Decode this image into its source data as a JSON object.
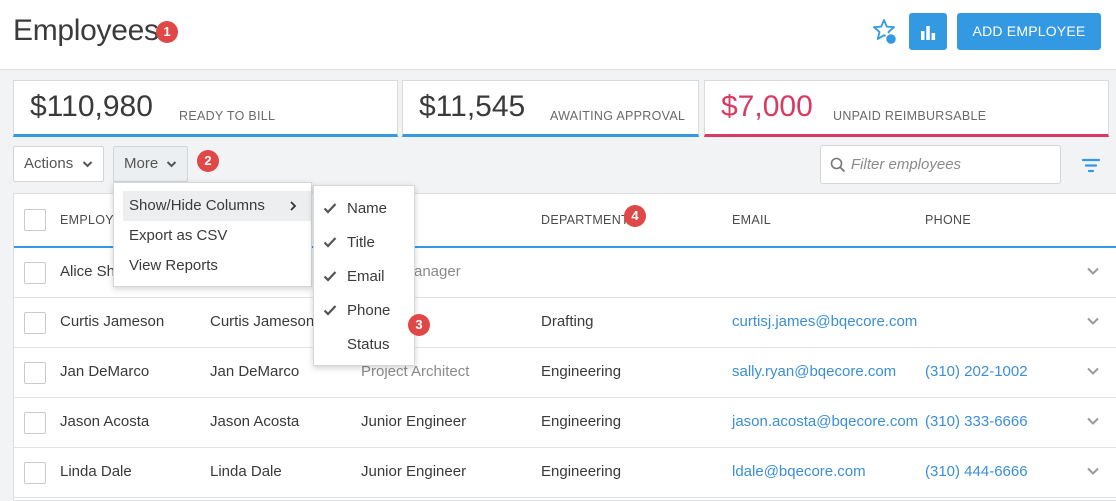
{
  "header": {
    "title": "Employees",
    "badge": "1",
    "add_button": "ADD EMPLOYEE",
    "icons": [
      "star-notification-icon",
      "bar-chart-icon"
    ]
  },
  "kpis": [
    {
      "value": "$110,980",
      "label": "READY TO BILL",
      "color": "#3499e3"
    },
    {
      "value": "$11,545",
      "label": "AWAITING APPROVAL",
      "color": "#3499e3"
    },
    {
      "value": "$7,000",
      "label": "UNPAID REIMBURSABLE",
      "color": "#d93a62"
    }
  ],
  "toolbar": {
    "actions_label": "Actions",
    "more_label": "More",
    "more_badge": "2",
    "filter_placeholder": "Filter employees"
  },
  "more_menu": {
    "items": [
      "Show/Hide Columns",
      "Export as CSV",
      "View Reports"
    ]
  },
  "columns_menu": {
    "badge": "3",
    "items": [
      {
        "label": "Name",
        "checked": true
      },
      {
        "label": "Title",
        "checked": true
      },
      {
        "label": "Email",
        "checked": true
      },
      {
        "label": "Phone",
        "checked": true
      },
      {
        "label": "Status",
        "checked": false
      }
    ]
  },
  "table": {
    "headers": {
      "employee": "EMPLOYEE",
      "department": "DEPARTMENT",
      "department_badge": "4",
      "email": "EMAIL",
      "phone": "PHONE"
    },
    "rows": [
      {
        "name": "Alice Sha",
        "display": "",
        "title": "anager",
        "department": "",
        "email": "",
        "phone": ""
      },
      {
        "name": "Curtis Jameson",
        "display": "Curtis Jameson",
        "title": "",
        "department": "Drafting",
        "email": "curtisj.james@bqecore.com",
        "phone": ""
      },
      {
        "name": "Jan DeMarco",
        "display": "Jan DeMarco",
        "title": "Project Architect",
        "department": "Engineering",
        "email": "sally.ryan@bqecore.com",
        "phone": "(310) 202-1002"
      },
      {
        "name": "Jason Acosta",
        "display": "Jason Acosta",
        "title": "Junior Engineer",
        "department": "Engineering",
        "email": "jason.acosta@bqecore.com",
        "phone": "(310) 333-6666"
      },
      {
        "name": "Linda Dale",
        "display": "Linda Dale",
        "title": "Junior Engineer",
        "department": "Engineering",
        "email": "ldale@bqecore.com",
        "phone": "(310) 444-6666"
      }
    ]
  },
  "colors": {
    "accent": "#3499e3",
    "alert": "#d93a62",
    "badge": "#e04848",
    "link": "#3a8fd8"
  }
}
